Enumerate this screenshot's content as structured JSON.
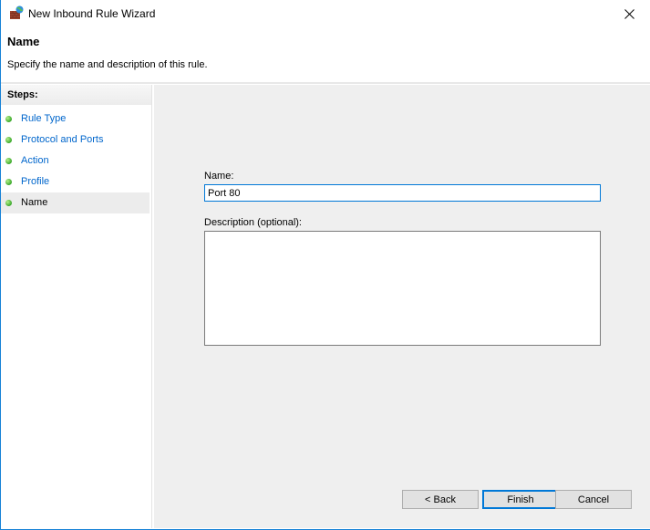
{
  "window": {
    "title": "New Inbound Rule Wizard",
    "icon": "firewall-icon",
    "close_icon": "close-icon"
  },
  "header": {
    "title": "Name",
    "subtitle": "Specify the name and description of this rule."
  },
  "steps": {
    "title": "Steps:",
    "items": [
      {
        "label": "Rule Type",
        "current": false
      },
      {
        "label": "Protocol and Ports",
        "current": false
      },
      {
        "label": "Action",
        "current": false
      },
      {
        "label": "Profile",
        "current": false
      },
      {
        "label": "Name",
        "current": true
      }
    ]
  },
  "form": {
    "name_label": "Name:",
    "name_value": "Port 80",
    "description_label": "Description (optional):",
    "description_value": ""
  },
  "buttons": {
    "back": "< Back",
    "finish": "Finish",
    "cancel": "Cancel"
  },
  "colors": {
    "accent": "#0078d7",
    "link": "#0066cc",
    "step_dot": "#3aa82b"
  }
}
